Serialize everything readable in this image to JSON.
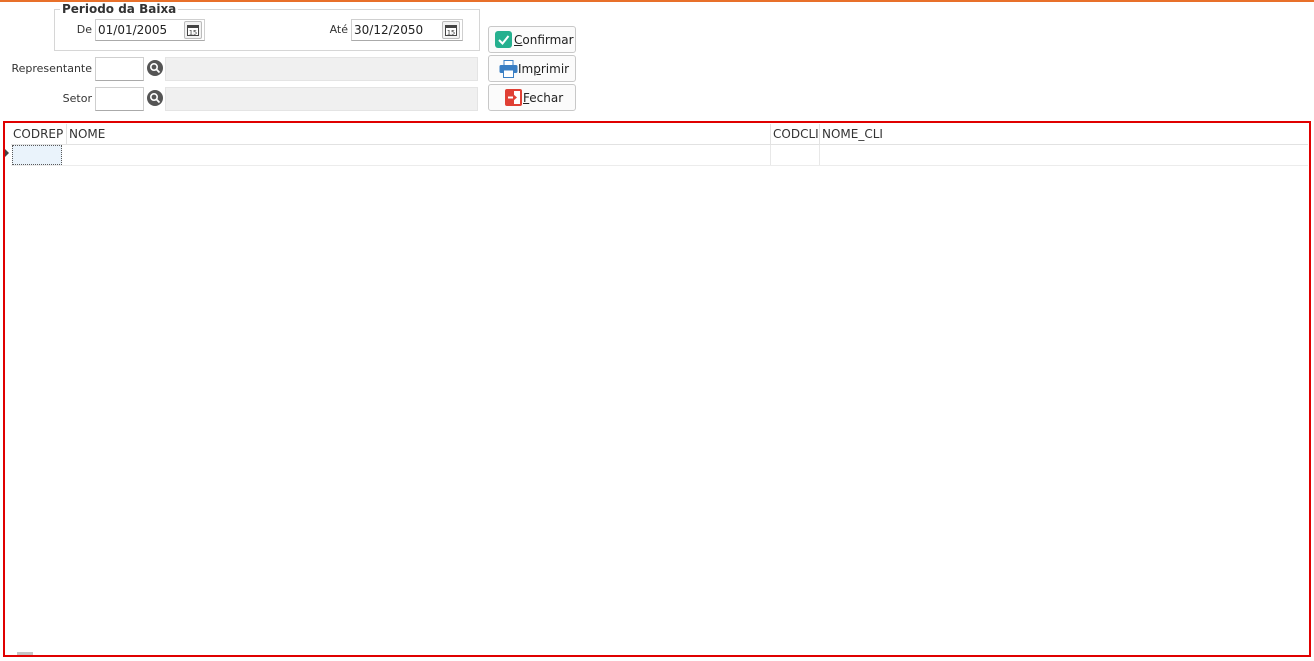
{
  "period": {
    "title": "Periodo da Baixa",
    "from_label": "De",
    "from_value": "01/01/2005",
    "to_label": "Até",
    "to_value": "30/12/2050"
  },
  "filters": {
    "representante_label": "Representante",
    "representante_code": "",
    "representante_desc": "",
    "setor_label": "Setor",
    "setor_code": "",
    "setor_desc": ""
  },
  "buttons": {
    "confirmar": {
      "first": "C",
      "rest": "onfirmar"
    },
    "imprimir": {
      "before": "Im",
      "underlined": "p",
      "after": "rimir"
    },
    "fechar": {
      "first": "F",
      "rest": "echar"
    }
  },
  "grid": {
    "columns": [
      "CODREP",
      "NOME",
      "CODCLI",
      "NOME_CLI"
    ],
    "rows": [
      [
        "",
        "",
        "",
        ""
      ]
    ]
  },
  "colors": {
    "accent": "#e8702a",
    "grid_border": "#e00000"
  }
}
